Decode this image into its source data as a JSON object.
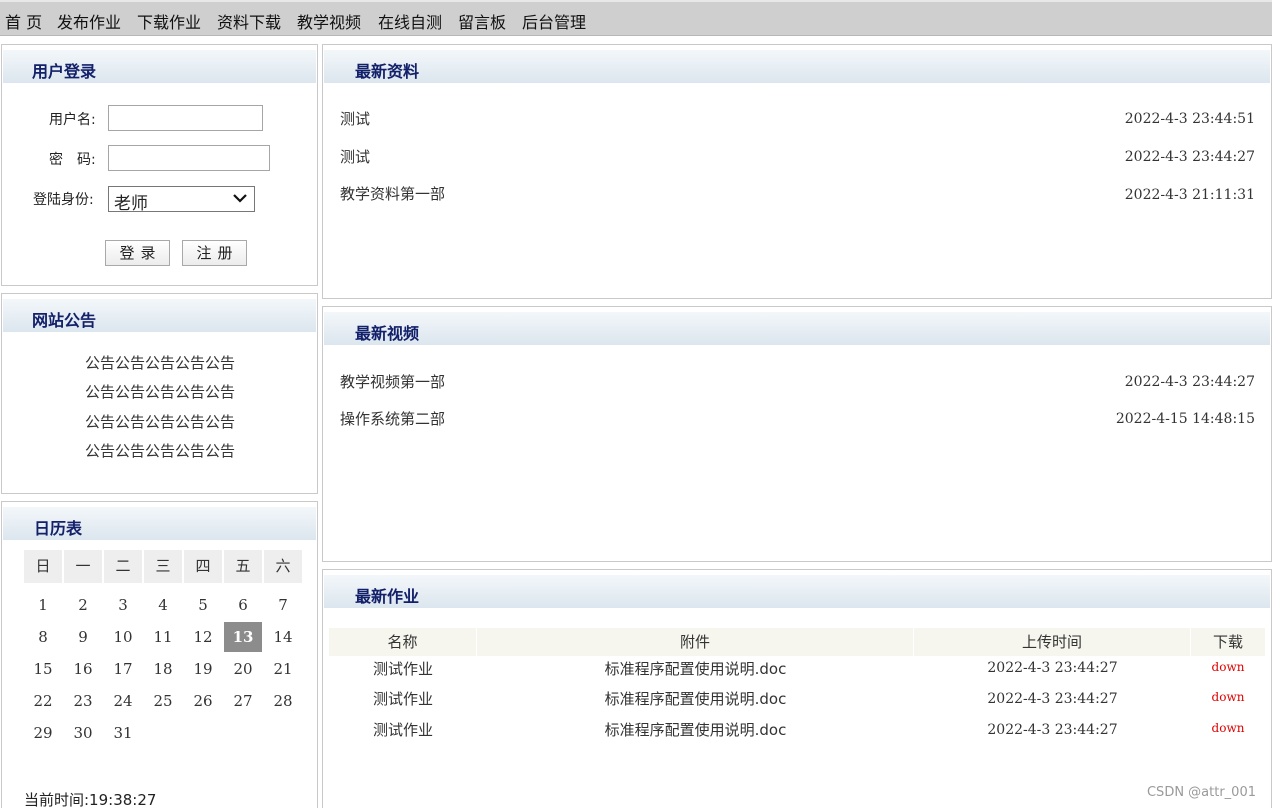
{
  "nav": [
    "首 页",
    "发布作业",
    "下载作业",
    "资料下载",
    "教学视频",
    "在线自测",
    "留言板",
    "后台管理"
  ],
  "login": {
    "title": "用户登录",
    "username_label": "用户名:",
    "password_label": "密　码:",
    "role_label": "登陆身份:",
    "role_value": "老师",
    "login_button": "登录",
    "register_button": "注册"
  },
  "notice": {
    "title": "网站公告",
    "lines": [
      "公告公告公告公告公告",
      "公告公告公告公告公告",
      "公告公告公告公告公告",
      "公告公告公告公告公告"
    ]
  },
  "calendar": {
    "title": "日历表",
    "weekdays": [
      "日",
      "一",
      "二",
      "三",
      "四",
      "五",
      "六"
    ],
    "days": [
      "1",
      "2",
      "3",
      "4",
      "5",
      "6",
      "7",
      "8",
      "9",
      "10",
      "11",
      "12",
      "13",
      "14",
      "15",
      "16",
      "17",
      "18",
      "19",
      "20",
      "21",
      "22",
      "23",
      "24",
      "25",
      "26",
      "27",
      "28",
      "29",
      "30",
      "31"
    ],
    "today": "13",
    "current_time": "当前时间:19:38:27"
  },
  "materials": {
    "title": "最新资料",
    "items": [
      {
        "title": "测试",
        "date": "2022-4-3 23:44:51"
      },
      {
        "title": "测试",
        "date": "2022-4-3 23:44:27"
      },
      {
        "title": "教学资料第一部",
        "date": "2022-4-3 21:11:31"
      }
    ]
  },
  "videos": {
    "title": "最新视频",
    "items": [
      {
        "title": "教学视频第一部",
        "date": "2022-4-3 23:44:27"
      },
      {
        "title": "操作系统第二部",
        "date": "2022-4-15 14:48:15"
      }
    ]
  },
  "homework": {
    "title": "最新作业",
    "columns": [
      "名称",
      "附件",
      "上传时间",
      "下载"
    ],
    "rows": [
      [
        "测试作业",
        "标准程序配置使用说明.doc",
        "2022-4-3 23:44:27",
        "down"
      ],
      [
        "测试作业",
        "标准程序配置使用说明.doc",
        "2022-4-3 23:44:27",
        "down"
      ],
      [
        "测试作业",
        "标准程序配置使用说明.doc",
        "2022-4-3 23:44:27",
        "down"
      ]
    ]
  },
  "watermark": "CSDN @attr_001"
}
